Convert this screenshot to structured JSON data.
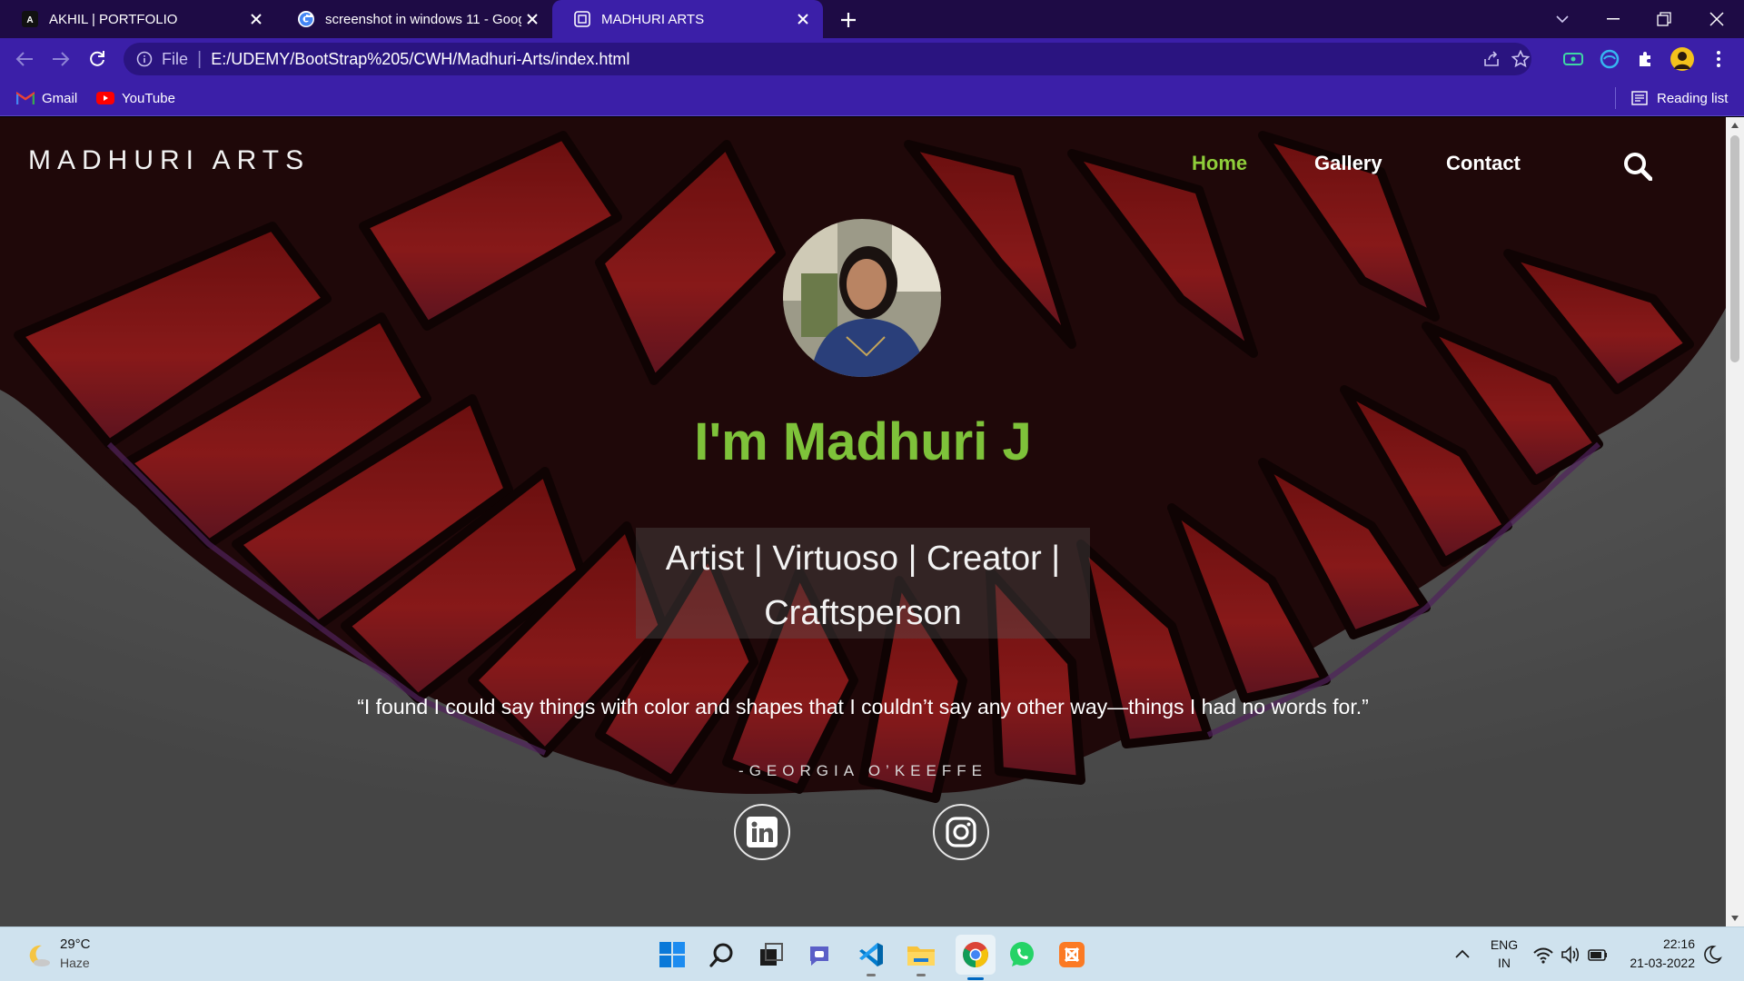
{
  "browser": {
    "tabs": [
      {
        "title": "AKHIL | PORTFOLIO",
        "icon": "akhil-favicon",
        "active": false
      },
      {
        "title": "screenshot in windows 11 - Goog",
        "icon": "google-icon",
        "active": false
      },
      {
        "title": "MADHURI ARTS",
        "icon": "page-favicon",
        "active": true
      }
    ],
    "address": {
      "scheme_label": "File",
      "url": "E:/UDEMY/BootStrap%205/CWH/Madhuri-Arts/index.html"
    },
    "bookmarks": [
      {
        "label": "Gmail",
        "icon": "gmail-icon"
      },
      {
        "label": "YouTube",
        "icon": "youtube-icon"
      }
    ],
    "reading_list": "Reading list",
    "colors": {
      "tabstrip": "#1e0b45",
      "toolbar": "#3b1fa8"
    }
  },
  "site": {
    "brand": "MADHURI ARTS",
    "nav": [
      {
        "label": "Home",
        "active": true
      },
      {
        "label": "Gallery",
        "active": false
      },
      {
        "label": "Contact",
        "active": false
      }
    ],
    "hero": {
      "heading": "I'm Madhuri J",
      "tagline": "Artist | Virtuoso | Creator | Craftsperson",
      "quote": "“I found I could say things with color and shapes that I couldn’t say any other way—things I had no words for.”",
      "quote_author": "-GEORGIA O’KEEFFE",
      "social": [
        "linkedin-icon",
        "instagram-icon"
      ]
    },
    "colors": {
      "accent": "#7ec23a",
      "nav_active": "#8fce3a"
    }
  },
  "taskbar": {
    "weather": {
      "temp": "29°C",
      "condition": "Haze"
    },
    "apps": [
      "windows-start-icon",
      "search-icon",
      "task-view-icon",
      "teams-chat-icon",
      "vscode-icon",
      "file-explorer-icon",
      "chrome-icon",
      "whatsapp-icon",
      "xampp-icon"
    ],
    "language": {
      "line1": "ENG",
      "line2": "IN"
    },
    "clock": {
      "time": "22:16",
      "date": "21-03-2022"
    }
  }
}
